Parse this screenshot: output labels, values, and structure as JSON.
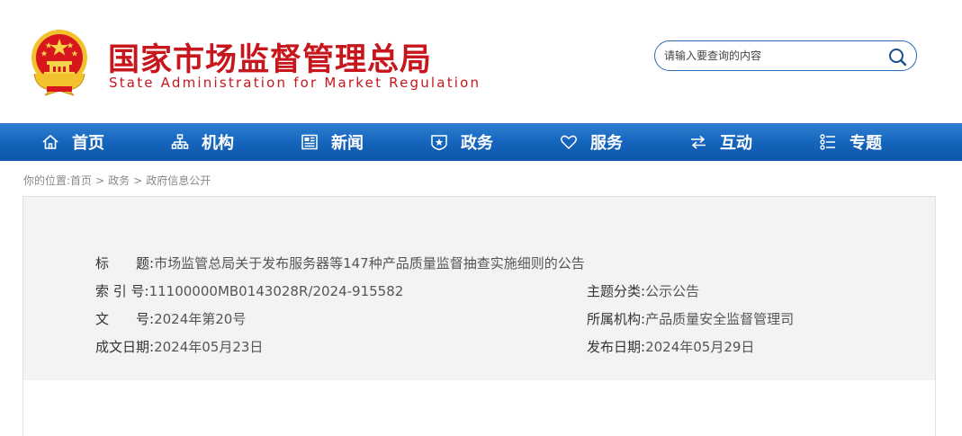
{
  "header": {
    "title_cn": "国家市场监督管理总局",
    "title_en": "State Administration for Market Regulation",
    "emblem": "national-emblem"
  },
  "search": {
    "placeholder": "请输入要查询的内容",
    "value": "",
    "icon": "search-icon"
  },
  "nav": {
    "items": [
      {
        "label": "首页",
        "icon": "home-icon"
      },
      {
        "label": "机构",
        "icon": "org-chart-icon"
      },
      {
        "label": "新闻",
        "icon": "newspaper-icon"
      },
      {
        "label": "政务",
        "icon": "government-badge-icon"
      },
      {
        "label": "服务",
        "icon": "heart-icon"
      },
      {
        "label": "互动",
        "icon": "exchange-arrows-icon"
      },
      {
        "label": "专题",
        "icon": "topic-list-icon"
      }
    ]
  },
  "breadcrumb": {
    "prefix": "你的位置:",
    "items": [
      "首页",
      "政务",
      "政府信息公开"
    ],
    "separator": ">"
  },
  "info": {
    "title_label": "标　　题:",
    "title_value": "市场监管总局关于发布服务器等147种产品质量监督抽查实施细则的公告",
    "index_label": "索 引 号:",
    "index_value": "11100000MB0143028R/2024-915582",
    "category_label": "主题分类:",
    "category_value": "公示公告",
    "docno_label": "文　　号:",
    "docno_value": "2024年第20号",
    "org_label": "所属机构:",
    "org_value": "产品质量安全监督管理司",
    "created_label": "成文日期:",
    "created_value": "2024年05月23日",
    "published_label": "发布日期:",
    "published_value": "2024年05月29日"
  },
  "colors": {
    "brand_red": "#c8161d",
    "nav_blue": "#1565bd",
    "panel_bg": "#f3f3f3"
  }
}
